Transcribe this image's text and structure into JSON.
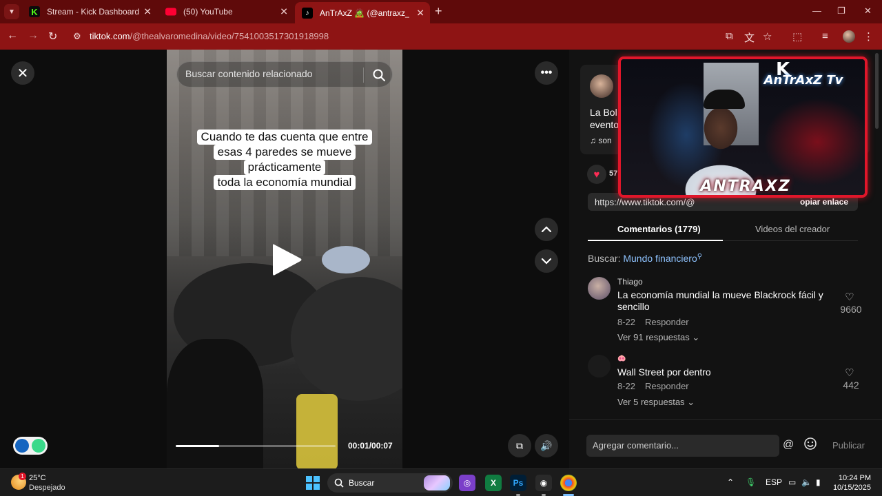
{
  "browser": {
    "tabs": [
      {
        "title": "Stream - Kick Dashboard",
        "color": "#53fc18"
      },
      {
        "title": "(50) YouTube",
        "color": "#ff0033"
      },
      {
        "title": "AnTrAxZ 🧟 (@antraxz_) | TikTok",
        "color": "#000000"
      }
    ],
    "url_host": "tiktok.com",
    "url_path": "/@thealvaromedina/video/7541003517301918998",
    "accent": "#8e1414"
  },
  "video": {
    "search_placeholder": "Buscar contenido relacionado",
    "caption_lines": [
      "Cuando te das cuenta que entre",
      "esas 4 paredes se mueve",
      "prácticamente",
      "toda la economía mundial"
    ],
    "time": "00:01/00:07",
    "progress_fraction": 0.27
  },
  "panel": {
    "desc": "La Bolsa eventos",
    "desc_line1": "La Bol",
    "desc_line2": "evento",
    "sound": "♫ son",
    "likes": "57",
    "copy_url": "https://www.tiktok.com/@",
    "copy_label": "opiar enlace",
    "tab_comments": "Comentarios (1779)",
    "tab_videos": "Videos del creador",
    "search_prefix": "Buscar:",
    "search_keyword": "Mundo financiero",
    "comments": [
      {
        "user": "Thiago",
        "text": "La economía mundial la mueve Blackrock fácil y sencillo",
        "date": "8-22",
        "reply": "Responder",
        "more": "Ver 91 respuestas",
        "likes": "9660"
      },
      {
        "user": "🐽",
        "text": "Wall Street por dentro",
        "date": "8-22",
        "reply": "Responder",
        "more": "Ver 5 respuestas",
        "likes": "442"
      }
    ],
    "add_comment_placeholder": "Agregar comentario...",
    "publish": "Publicar"
  },
  "webcam": {
    "name": "ANTRAXZ",
    "logo_k": "K",
    "logo_text": "AnTrAxZ Tv",
    "frame_color": "#e0162a"
  },
  "taskbar": {
    "temp": "25°C",
    "condition": "Despejado",
    "weather_badge": "1",
    "search": "Buscar",
    "lang": "ESP",
    "time": "10:24 PM",
    "date": "10/15/2025"
  }
}
